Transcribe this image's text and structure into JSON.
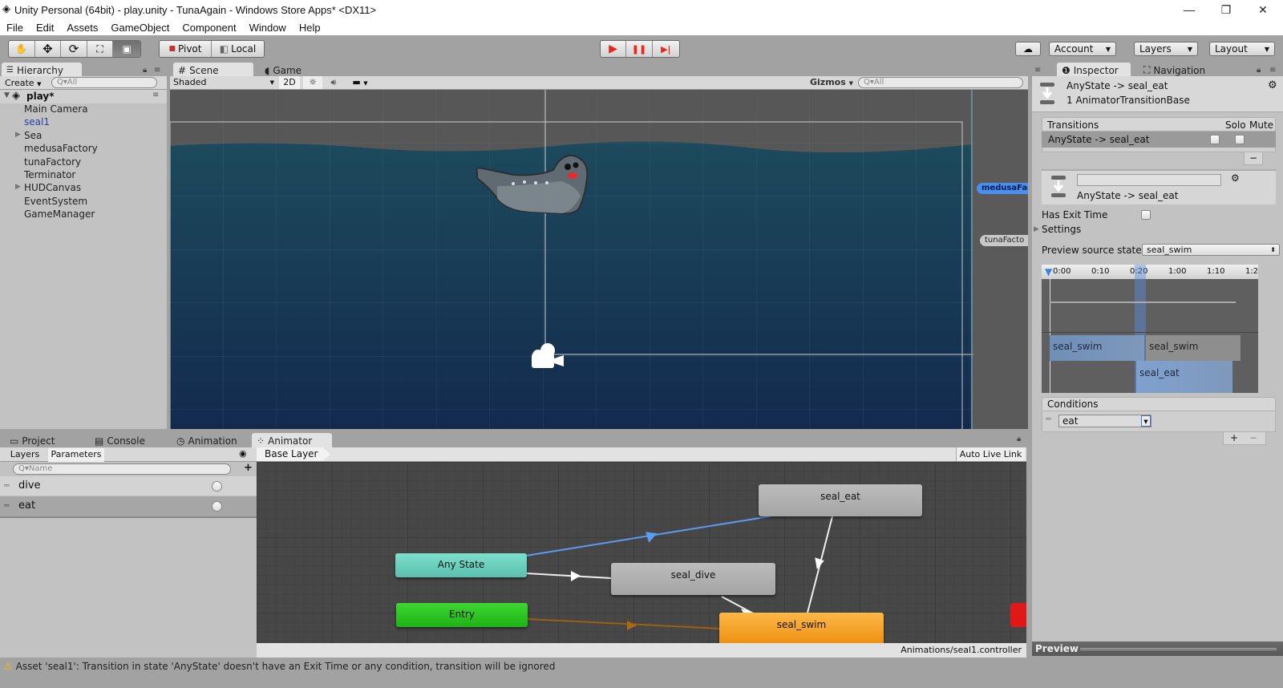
{
  "window": {
    "title": "Unity Personal (64bit) - play.unity - TunaAgain - Windows Store Apps* <DX11>",
    "controls": {
      "minimize": "—",
      "restore": "❐",
      "close": "✕"
    }
  },
  "menu": [
    "File",
    "Edit",
    "Assets",
    "GameObject",
    "Component",
    "Window",
    "Help"
  ],
  "toolbar": {
    "tools": [
      "hand-tool",
      "move-tool",
      "rotate-tool",
      "scale-tool",
      "rect-tool"
    ],
    "pivot_label": "Pivot",
    "local_label": "Local",
    "play_icons": {
      "play": "▶",
      "pause": "❚❚",
      "step": "▶|"
    },
    "account_label": "Account",
    "layers_label": "Layers",
    "layout_label": "Layout",
    "play_color": "#e8261a"
  },
  "hierarchy": {
    "tab_label": "Hierarchy",
    "create_label": "Create",
    "search_placeholder": "Q▾All",
    "scene_name": "play*",
    "items": [
      {
        "label": "Main Camera",
        "expandable": false,
        "selected": false
      },
      {
        "label": "seal1",
        "expandable": false,
        "selected": true
      },
      {
        "label": "Sea",
        "expandable": true,
        "selected": false
      },
      {
        "label": "medusaFactory",
        "expandable": false,
        "selected": false
      },
      {
        "label": "tunaFactory",
        "expandable": false,
        "selected": false
      },
      {
        "label": "Terminator",
        "expandable": false,
        "selected": false
      },
      {
        "label": "HUDCanvas",
        "expandable": true,
        "selected": false
      },
      {
        "label": "EventSystem",
        "expandable": false,
        "selected": false
      },
      {
        "label": "GameManager",
        "expandable": false,
        "selected": false
      }
    ]
  },
  "scene": {
    "tab_scene": "Scene",
    "tab_game": "Game",
    "shading_mode": "Shaded",
    "mode_2d": "2D",
    "gizmos_label": "Gizmos",
    "search_placeholder": "Q▾All",
    "labels": [
      "medusaFac",
      "tunaFacto"
    ]
  },
  "inspector": {
    "tab_inspector": "Inspector",
    "tab_navigation": "Navigation",
    "header_title": "AnyState -> seal_eat",
    "header_subtitle": "1 AnimatorTransitionBase",
    "transitions_header": "Transitions",
    "solo_label": "Solo",
    "mute_label": "Mute",
    "transition_row": "AnyState -> seal_eat",
    "remove_label": "−",
    "transition_name_value": "",
    "transition_caption": "AnyState -> seal_eat",
    "has_exit_time_label": "Has Exit Time",
    "has_exit_time": false,
    "settings_label": "Settings",
    "preview_source_label": "Preview source state",
    "preview_source_value": "seal_swim",
    "timeline_ticks": [
      "0:00",
      "0:10",
      "0:20",
      "1:00",
      "1:10",
      "1:2"
    ],
    "timeline_clips": [
      {
        "label": "seal_swim",
        "track": "source"
      },
      {
        "label": "seal_swim",
        "track": "source-after"
      },
      {
        "label": "seal_eat",
        "track": "destination"
      }
    ],
    "conditions_header": "Conditions",
    "condition_param": "eat",
    "add_label": "+",
    "remove_condition_label": "−",
    "preview_label": "Preview"
  },
  "bottom": {
    "tabs": [
      "Project",
      "Console",
      "Animation",
      "Animator"
    ],
    "active_tab": "Animator",
    "subtabs": [
      "Layers",
      "Parameters"
    ],
    "params_search_placeholder": "Q▾Name",
    "add_param": "+",
    "parameters": [
      {
        "name": "dive",
        "type": "trigger",
        "selected": false
      },
      {
        "name": "eat",
        "type": "trigger",
        "selected": true
      }
    ],
    "breadcrumb": "Base Layer",
    "auto_live_link": "Auto Live Link",
    "controller_path": "Animations/seal1.controller"
  },
  "animator": {
    "states": [
      {
        "id": "seal_eat",
        "label": "seal_eat",
        "color": "#b4b4b4"
      },
      {
        "id": "any_state",
        "label": "Any State",
        "color": "#6fd1c0"
      },
      {
        "id": "seal_dive",
        "label": "seal_dive",
        "color": "#b4b4b4"
      },
      {
        "id": "entry",
        "label": "Entry",
        "color": "#2ec225"
      },
      {
        "id": "seal_swim",
        "label": "seal_swim",
        "color": "#f5a623"
      }
    ],
    "transitions": [
      {
        "from": "any_state",
        "to": "seal_eat",
        "selected": true,
        "color": "#5b9bf0"
      },
      {
        "from": "any_state",
        "to": "seal_dive",
        "selected": false,
        "color": "#ffffff"
      },
      {
        "from": "seal_dive",
        "to": "seal_swim",
        "selected": false,
        "color": "#ffffff"
      },
      {
        "from": "seal_eat",
        "to": "seal_swim",
        "selected": false,
        "color": "#ffffff"
      },
      {
        "from": "entry",
        "to": "seal_swim",
        "selected": false,
        "color": "#a86a10"
      }
    ]
  },
  "status": {
    "message": "Asset 'seal1': Transition in state 'AnyState' doesn't have an Exit Time or any condition, transition will be ignored"
  }
}
